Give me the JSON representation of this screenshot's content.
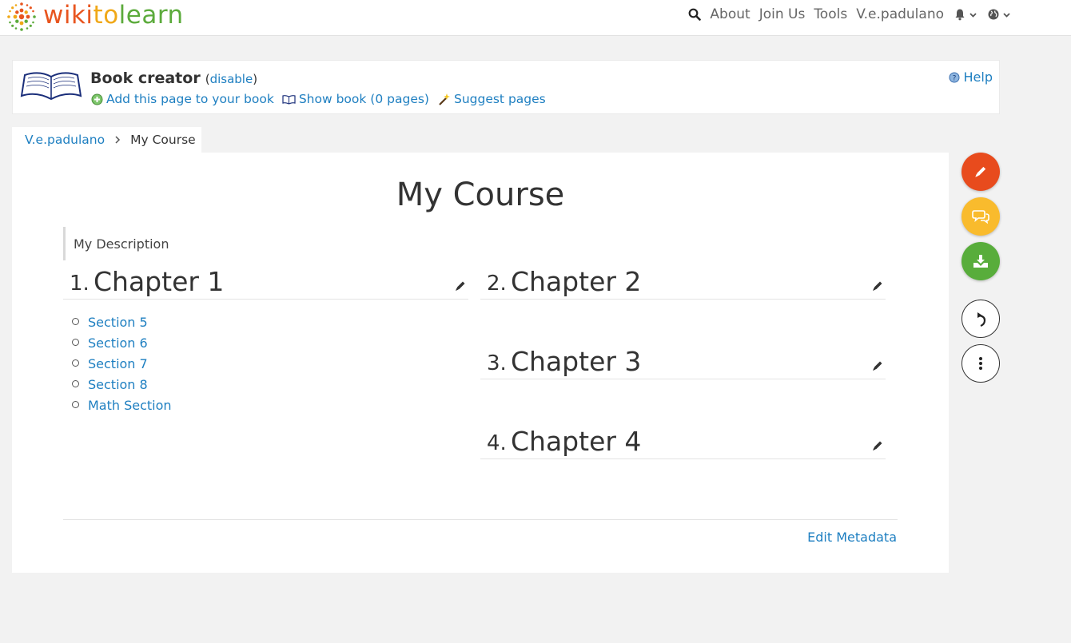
{
  "header": {
    "logo": {
      "p1": "wiki",
      "p2": "to",
      "p3": "learn"
    },
    "nav": [
      {
        "label": "About"
      },
      {
        "label": "Join Us"
      },
      {
        "label": "Tools"
      },
      {
        "label": "V.e.padulano"
      }
    ],
    "icons": [
      "search-icon",
      "bell-icon",
      "globe-icon",
      "chevron-down-icon"
    ]
  },
  "book_creator": {
    "title": "Book creator",
    "disable_label": "disable",
    "add_page": "Add this page to your book",
    "show_book": "Show book (0 pages)",
    "suggest": "Suggest pages",
    "help": "Help"
  },
  "breadcrumb": {
    "parent": "V.e.padulano",
    "current": "My Course"
  },
  "page": {
    "title": "My Course",
    "description": "My Description",
    "chapters": [
      {
        "num": "1.",
        "name": "Chapter 1"
      },
      {
        "num": "2.",
        "name": "Chapter 2"
      },
      {
        "num": "3.",
        "name": "Chapter 3"
      },
      {
        "num": "4.",
        "name": "Chapter 4"
      }
    ],
    "sections": [
      "Section 5",
      "Section 6",
      "Section 7",
      "Section 8",
      "Math Section"
    ],
    "edit_metadata": "Edit Metadata"
  },
  "actions": [
    {
      "icon": "pencil-icon",
      "color": "#e84b1d"
    },
    {
      "icon": "comments-icon",
      "color": "#f9bb2d"
    },
    {
      "icon": "download-icon",
      "color": "#58ad3b"
    },
    {
      "icon": "undo-icon"
    },
    {
      "icon": "more-vertical-icon"
    }
  ],
  "colors": {
    "link": "#1e7fc1",
    "logo_wiki": "#e8551f",
    "logo_to": "#f0a818",
    "logo_learn": "#5cab3c"
  }
}
